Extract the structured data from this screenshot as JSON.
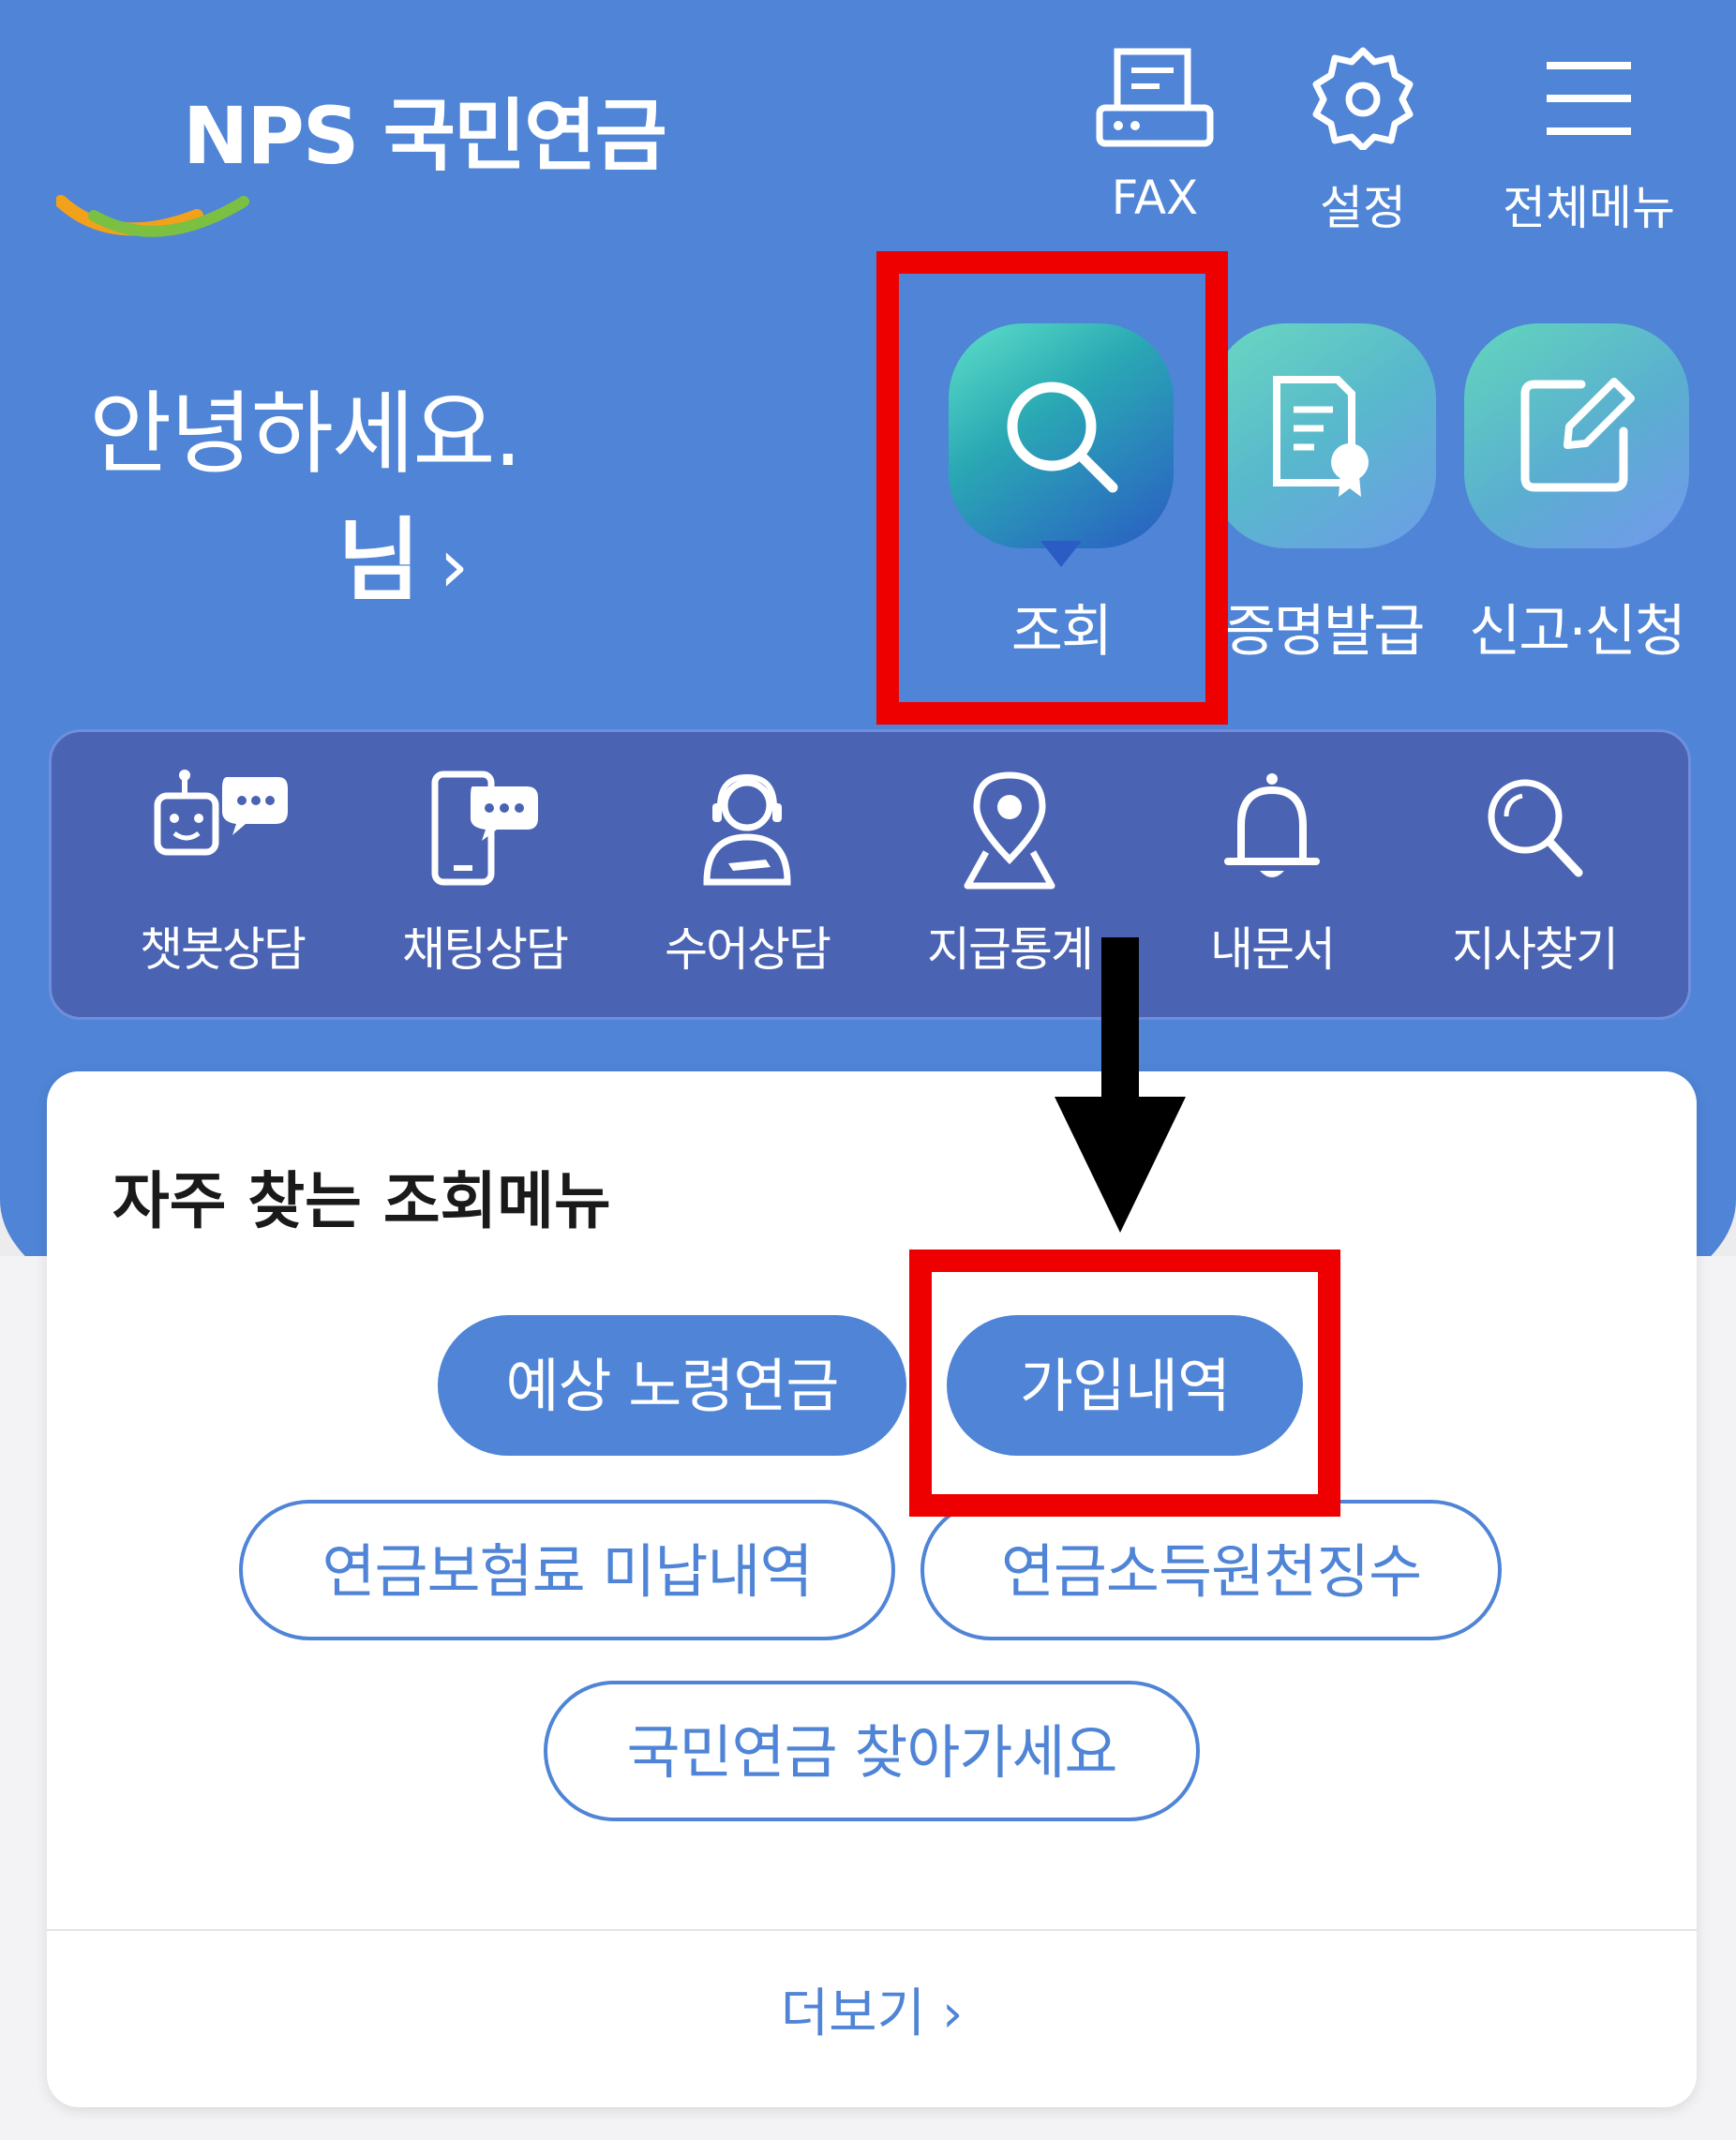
{
  "header": {
    "logo_text": "NPS 국민연금",
    "fax_label": "FAX",
    "settings_label": "설정",
    "menu_label": "전체메뉴"
  },
  "greeting": {
    "text": "안녕하세요.",
    "user_suffix": "님",
    "chevron": "›"
  },
  "main_shortcuts": [
    {
      "label": "조회",
      "icon": "search-icon"
    },
    {
      "label": "증명발급",
      "icon": "certificate-icon"
    },
    {
      "label": "신고·신청",
      "icon": "edit-icon"
    }
  ],
  "quick_menu": [
    {
      "label": "챗봇상담",
      "icon": "chatbot-icon"
    },
    {
      "label": "채팅상담",
      "icon": "chat-phone-icon"
    },
    {
      "label": "수어상담",
      "icon": "sign-language-icon"
    },
    {
      "label": "지급통계",
      "icon": "location-pin-icon"
    },
    {
      "label": "내문서",
      "icon": "bell-icon"
    },
    {
      "label": "지사찾기",
      "icon": "search-icon"
    }
  ],
  "frequent_menu": {
    "title": "자주 찾는 조회메뉴",
    "buttons": [
      {
        "label": "예상 노령연금"
      },
      {
        "label": "가입내역"
      },
      {
        "label": "연금보험료 미납내역"
      },
      {
        "label": "연금소득원천징수"
      },
      {
        "label": "국민연금 찾아가세요"
      }
    ],
    "more_label": "더보기 ›"
  },
  "colors": {
    "brand_blue": "#4f84d6",
    "quick_bar": "#4a63b2",
    "highlight_red": "#ee0000"
  }
}
